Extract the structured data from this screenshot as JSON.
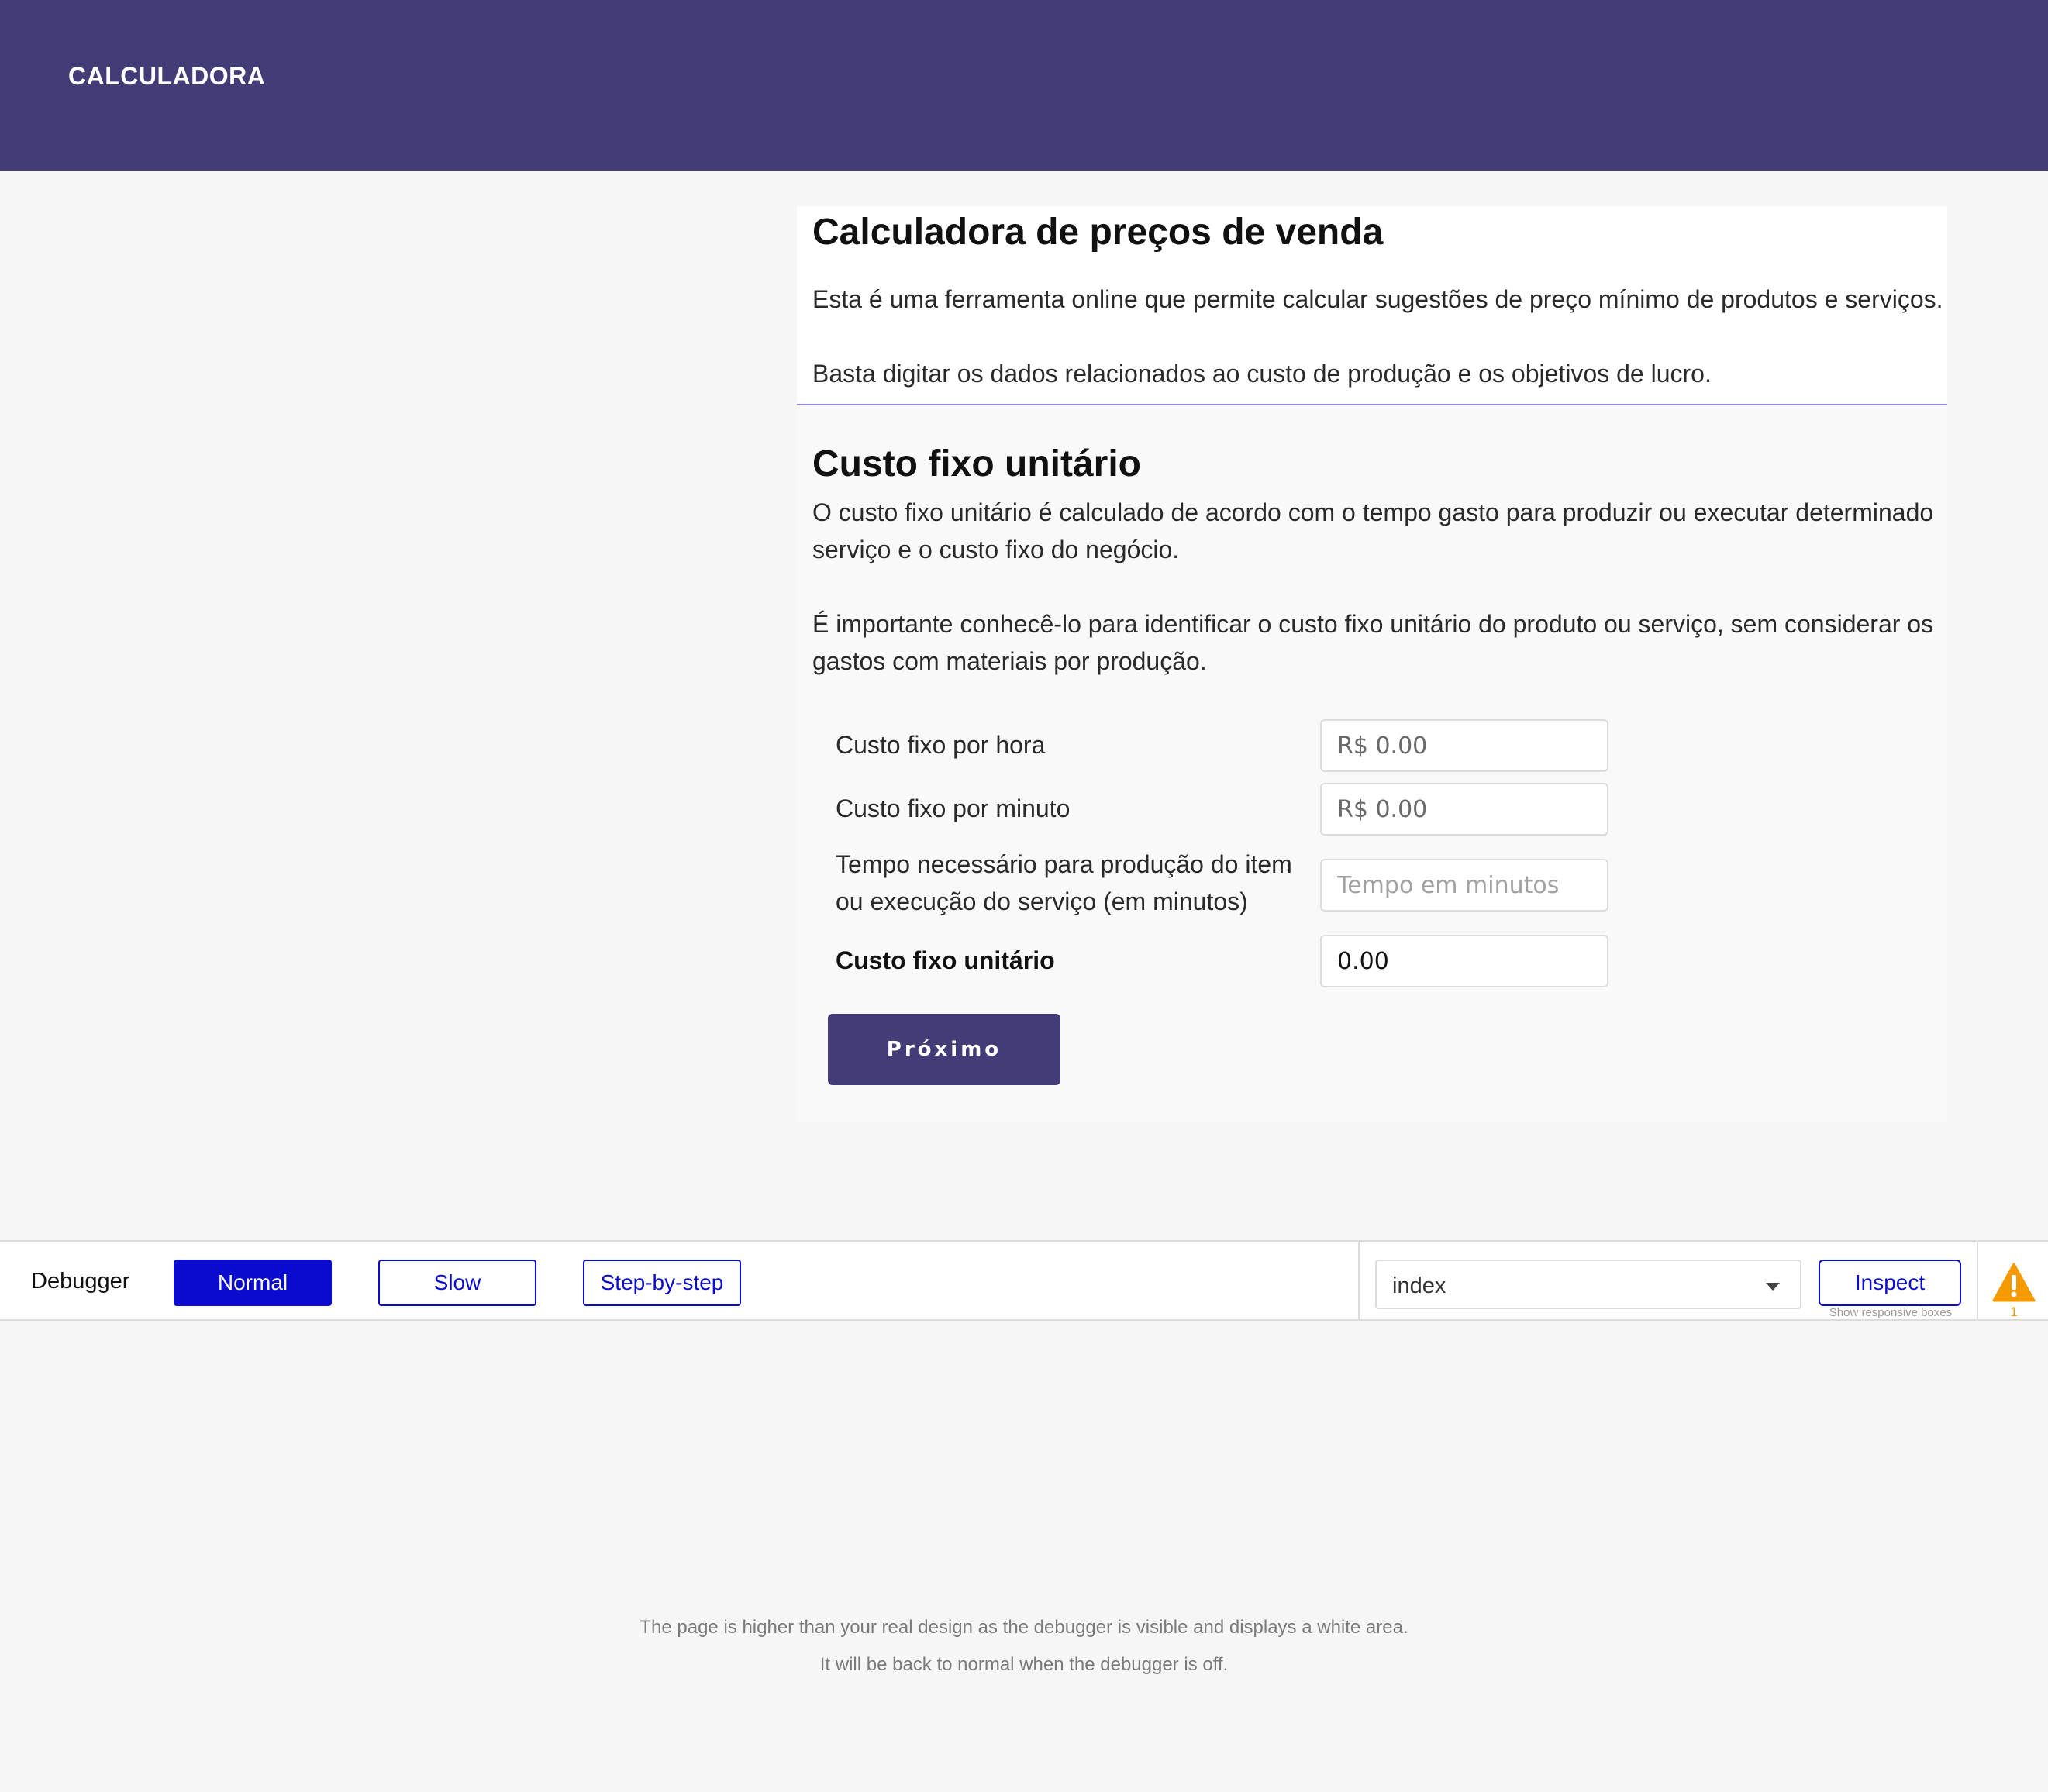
{
  "header": {
    "brand": "CALCULADORA",
    "color": "#443c77"
  },
  "intro": {
    "title": "Calculadora de preços de venda",
    "line1": "Esta é uma ferramenta online que permite calcular sugestões de preço mínimo de produtos e serviços.",
    "line2": "Basta digitar os dados relacionados ao custo de produção e os objetivos de lucro."
  },
  "section": {
    "title": "Custo fixo unitário",
    "para1": "O custo fixo unitário é calculado de acordo com o tempo gasto para produzir ou executar determinado serviço e o custo fixo do negócio.",
    "para2": "É importante conhecê-lo para identificar o custo fixo unitário do produto ou serviço, sem considerar os gastos com materiais por produção.",
    "fields": {
      "hourly": {
        "label": "Custo fixo por hora",
        "value": "R$ 0.00"
      },
      "minute": {
        "label": "Custo fixo por minuto",
        "value": "R$ 0.00"
      },
      "time": {
        "label": "Tempo necessário para produção do item ou execução do serviço (em minutos)",
        "placeholder": "Tempo em minutos"
      },
      "unit": {
        "label": "Custo fixo unitário",
        "value": "0.00"
      }
    },
    "next_label": "Próximo"
  },
  "debugger": {
    "label": "Debugger",
    "modes": {
      "normal": "Normal",
      "slow": "Slow",
      "step": "Step-by-step"
    },
    "active_mode": "Normal",
    "page_select": "index",
    "inspect_label": "Inspect",
    "inspect_sub": "Show responsive boxes",
    "warning_count": "1",
    "accent": "#0b0bd0",
    "warning_color": "#f59a00"
  },
  "footer_note": {
    "line1": "The page is higher than your real design as the debugger is visible and displays a white area.",
    "line2": "It will be back to normal when the debugger is off."
  }
}
